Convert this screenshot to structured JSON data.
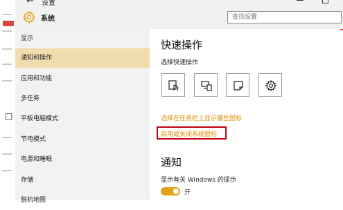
{
  "window": {
    "title": "设置",
    "back_glyph": "←"
  },
  "header": {
    "app_name": "系统",
    "search_placeholder": "查找设置"
  },
  "sidebar": {
    "items": [
      {
        "label": "显示",
        "active": false
      },
      {
        "label": "通知和操作",
        "active": true
      },
      {
        "label": "应用和功能",
        "active": false
      },
      {
        "label": "多任务",
        "active": false
      },
      {
        "label": "平板电脑模式",
        "active": false
      },
      {
        "label": "节电模式",
        "active": false
      },
      {
        "label": "电源和睡眠",
        "active": false
      },
      {
        "label": "存储",
        "active": false
      },
      {
        "label": "脱机地图",
        "active": false
      }
    ]
  },
  "quick_actions": {
    "title": "快速操作",
    "subtitle": "选择快速操作",
    "buttons": [
      {
        "icon": "tablet-mode-icon"
      },
      {
        "icon": "connect-icon"
      },
      {
        "icon": "note-icon"
      },
      {
        "icon": "settings-icon"
      }
    ],
    "link_taskbar_icons": "选择在任务栏上显示哪些图标",
    "link_system_icons": "启用或关闭系统图标"
  },
  "notifications": {
    "title": "通知",
    "windows_tips_label": "显示有关 Windows 的提示",
    "toggle_state": "开",
    "toggle_on": true
  },
  "colors": {
    "accent": "#e3a21a",
    "link": "#e08d00",
    "highlight_box": "#c0000e",
    "sidebar_active": "#f1dcae"
  }
}
